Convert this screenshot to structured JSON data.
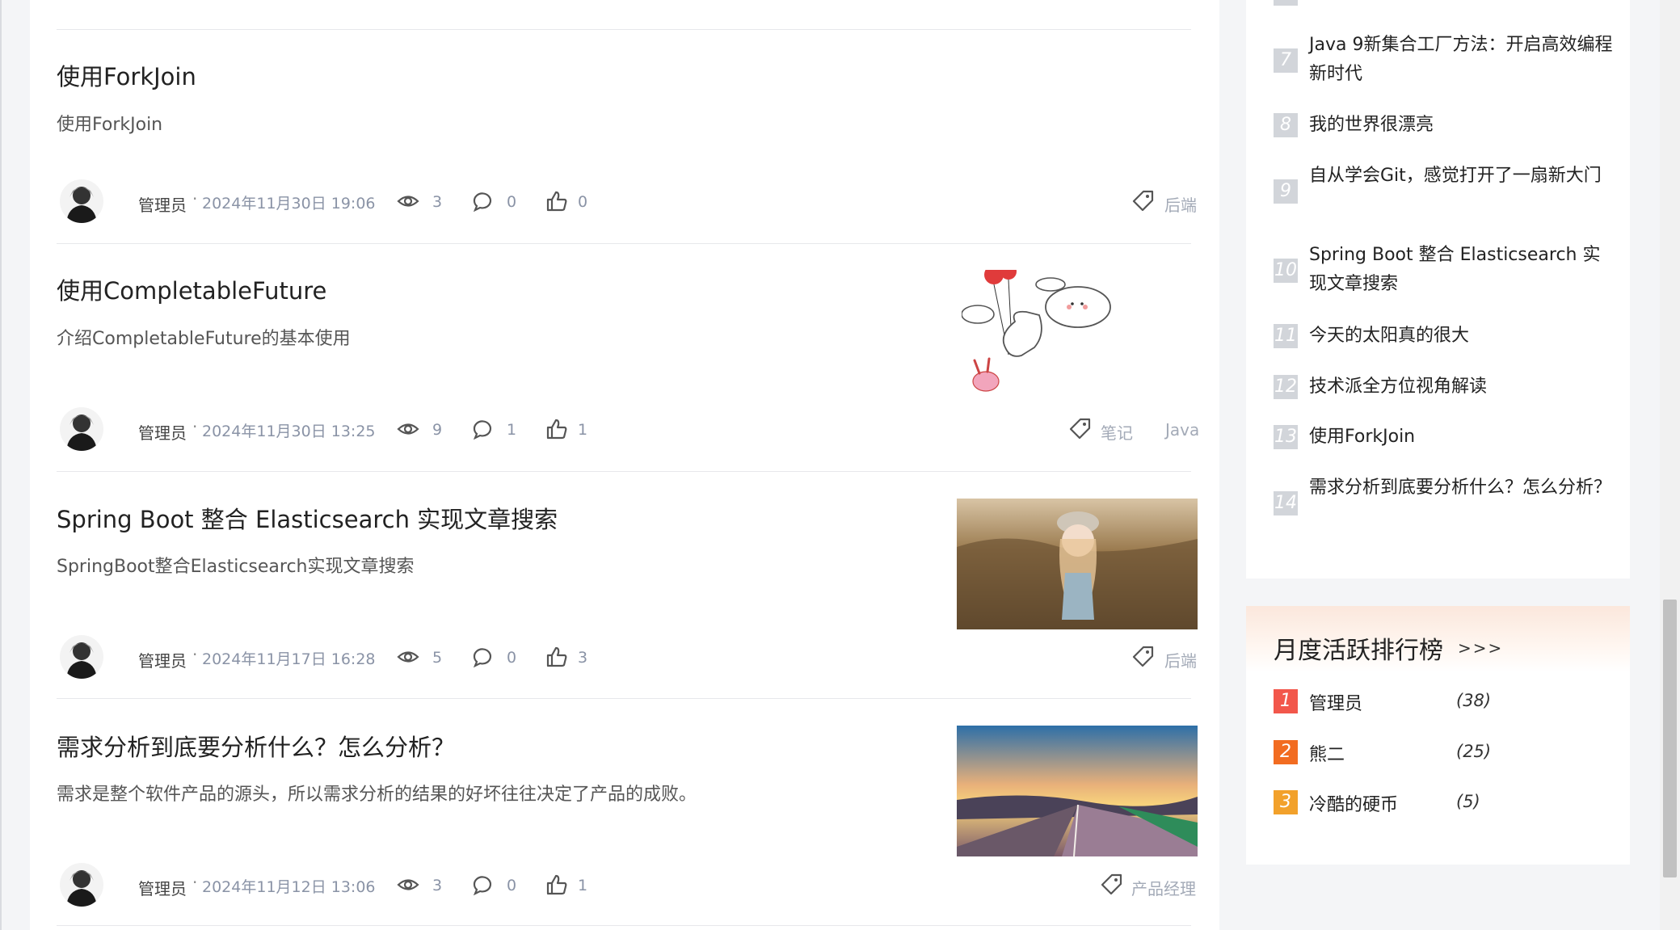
{
  "articles": [
    {
      "title": "使用ForkJoin",
      "desc": "使用ForkJoin",
      "author": "管理员",
      "date": "2024年11月30日 19:06",
      "views": "3",
      "comments": "0",
      "likes": "0",
      "tags": [
        "后端"
      ]
    },
    {
      "title": "使用CompletableFuture",
      "desc": "介绍CompletableFuture的基本使用",
      "author": "管理员",
      "date": "2024年11月30日 13:25",
      "views": "9",
      "comments": "1",
      "likes": "1",
      "tags": [
        "笔记",
        "Java"
      ]
    },
    {
      "title": "Spring Boot 整合 Elasticsearch 实现文章搜索",
      "desc": "SpringBoot整合Elasticsearch实现文章搜索",
      "author": "管理员",
      "date": "2024年11月17日 16:28",
      "views": "5",
      "comments": "0",
      "likes": "3",
      "tags": [
        "后端"
      ]
    },
    {
      "title": "需求分析到底要分析什么？怎么分析？",
      "desc": "需求是整个软件产品的源头，所以需求分析的结果的好坏往往决定了产品的成败。",
      "author": "管理员",
      "date": "2024年11月12日 13:06",
      "views": "3",
      "comments": "0",
      "likes": "1",
      "tags": [
        "产品经理"
      ]
    }
  ],
  "ranking": [
    {
      "num": "7",
      "title": "Java 9新集合工厂方法：开启高效编程新时代"
    },
    {
      "num": "8",
      "title": "我的世界很漂亮"
    },
    {
      "num": "9",
      "title": "自从学会Git，感觉打开了一扇新大门"
    },
    {
      "num": "10",
      "title": "Spring Boot 整合 Elasticsearch 实现文章搜索"
    },
    {
      "num": "11",
      "title": "今天的太阳真的很大"
    },
    {
      "num": "12",
      "title": "技术派全方位视角解读"
    },
    {
      "num": "13",
      "title": "使用ForkJoin"
    },
    {
      "num": "14",
      "title": "需求分析到底要分析什么？怎么分析？"
    }
  ],
  "active": {
    "title": "月度活跃排行榜",
    "more": ">>>",
    "items": [
      {
        "num": "1",
        "name": "管理员",
        "count": "(38)",
        "color": "#f2574b"
      },
      {
        "num": "2",
        "name": "熊二",
        "count": "(25)",
        "color": "#f26c21"
      },
      {
        "num": "3",
        "name": "冷酷的硬币",
        "count": "(5)",
        "color": "#f2a12b"
      }
    ]
  },
  "colors": {
    "meta_text": "#8a93a6",
    "divider": "#e7e8eb",
    "rank_badge": "#d2d5da"
  }
}
